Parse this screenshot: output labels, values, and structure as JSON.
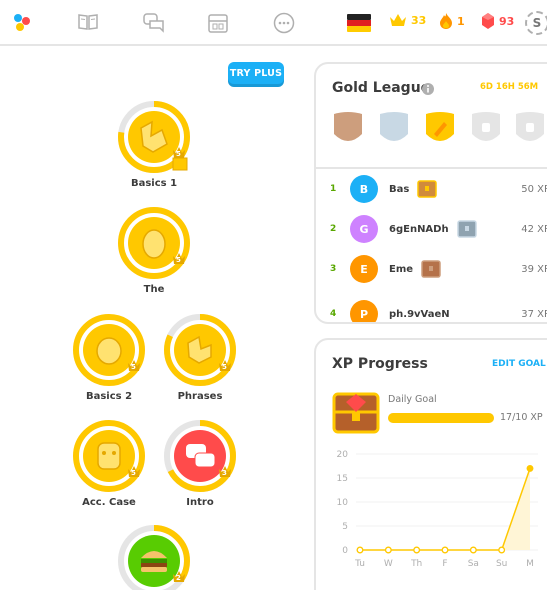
{
  "topbar": {
    "flag_country": "Germany",
    "crowns": "33",
    "streak": "1",
    "gems": "93",
    "profile_initial": "S",
    "icons": [
      "duolingo-logo-icon",
      "book-icon",
      "chat-bubbles-icon",
      "shop-icon",
      "more-icon"
    ]
  },
  "try_plus": "TRY PLUS",
  "skills": [
    {
      "label": "Basics 1",
      "level": "5"
    },
    {
      "label": "The",
      "level": "5"
    },
    {
      "label": "Basics 2",
      "level": "5"
    },
    {
      "label": "Phrases",
      "level": "5"
    },
    {
      "label": "Acc. Case",
      "level": "5"
    },
    {
      "label": "Intro",
      "level": "3"
    },
    {
      "label": "",
      "level": "2"
    }
  ],
  "league": {
    "title": "Gold League",
    "timer": "6D 16H 56M",
    "rows": [
      {
        "rank": "1",
        "initial": "B",
        "name": "Bas",
        "xp": "50 XP",
        "color": "#1cb0f6"
      },
      {
        "rank": "2",
        "initial": "G",
        "name": "6gEnNADh",
        "xp": "42 XP",
        "color": "#ce82ff"
      },
      {
        "rank": "3",
        "initial": "E",
        "name": "Eme",
        "xp": "39 XP",
        "color": "#ff9600"
      },
      {
        "rank": "4",
        "initial": "P",
        "name": "ph.9vVaeN",
        "xp": "37 XP",
        "color": "#ff9600"
      }
    ]
  },
  "xp_progress": {
    "title": "XP Progress",
    "edit_goal": "EDIT GOAL",
    "daily_goal_label": "Daily Goal",
    "daily_goal_value": "17/10 XP",
    "daily_goal_fraction": 1.0
  },
  "chart_data": {
    "type": "line",
    "categories": [
      "Tu",
      "W",
      "Th",
      "F",
      "Sa",
      "Su",
      "M"
    ],
    "values": [
      0,
      0,
      0,
      0,
      0,
      0,
      17
    ],
    "yticks": [
      "20",
      "15",
      "10",
      "5",
      "0"
    ],
    "ylim": [
      0,
      20
    ],
    "goal": 10,
    "colors": {
      "line": "#ffc800",
      "goal_tick": "#ffc800",
      "tick": "#afafaf"
    }
  }
}
